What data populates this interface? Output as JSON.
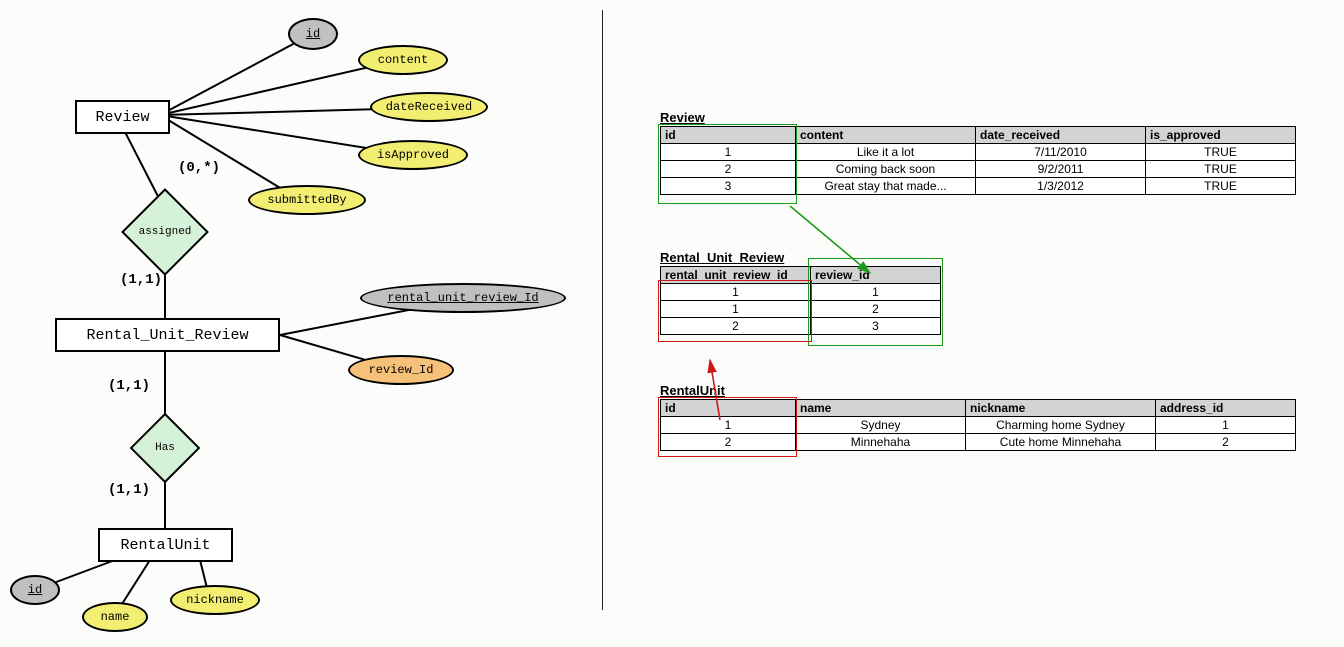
{
  "er": {
    "entities": {
      "review": "Review",
      "rur": "Rental_Unit_Review",
      "ru": "RentalUnit"
    },
    "attrs": {
      "review": {
        "id": "id",
        "content": "content",
        "dateReceived": "dateReceived",
        "isApproved": "isApproved",
        "submittedBy": "submittedBy"
      },
      "rur": {
        "rurId": "rental_unit_review_Id",
        "reviewId": "review_Id"
      },
      "ru": {
        "id": "id",
        "name": "name",
        "nickname": "nickname"
      }
    },
    "rels": {
      "assigned": "assigned",
      "has": "Has"
    },
    "card": {
      "review_assigned": "(0,*)",
      "assigned_rur": "(1,1)",
      "rur_has_top": "(1,1)",
      "has_ru": "(1,1)"
    }
  },
  "tables": {
    "review": {
      "name": "Review",
      "cols": [
        "id",
        "content",
        "date_received",
        "is_approved"
      ],
      "rows": [
        [
          "1",
          "Like it a lot",
          "7/11/2010",
          "TRUE"
        ],
        [
          "2",
          "Coming back soon",
          "9/2/2011",
          "TRUE"
        ],
        [
          "3",
          "Great stay that made...",
          "1/3/2012",
          "TRUE"
        ]
      ]
    },
    "rur": {
      "name": "Rental_Unit_Review",
      "cols": [
        "rental_unit_review_id",
        "review_id"
      ],
      "rows": [
        [
          "1",
          "1"
        ],
        [
          "1",
          "2"
        ],
        [
          "2",
          "3"
        ]
      ]
    },
    "ru": {
      "name": "RentalUnit",
      "cols": [
        "id",
        "name",
        "nickname",
        "address_id"
      ],
      "rows": [
        [
          "1",
          "Sydney",
          "Charming home Sydney",
          "1"
        ],
        [
          "2",
          "Minnehaha",
          "Cute home Minnehaha",
          "2"
        ]
      ]
    }
  }
}
